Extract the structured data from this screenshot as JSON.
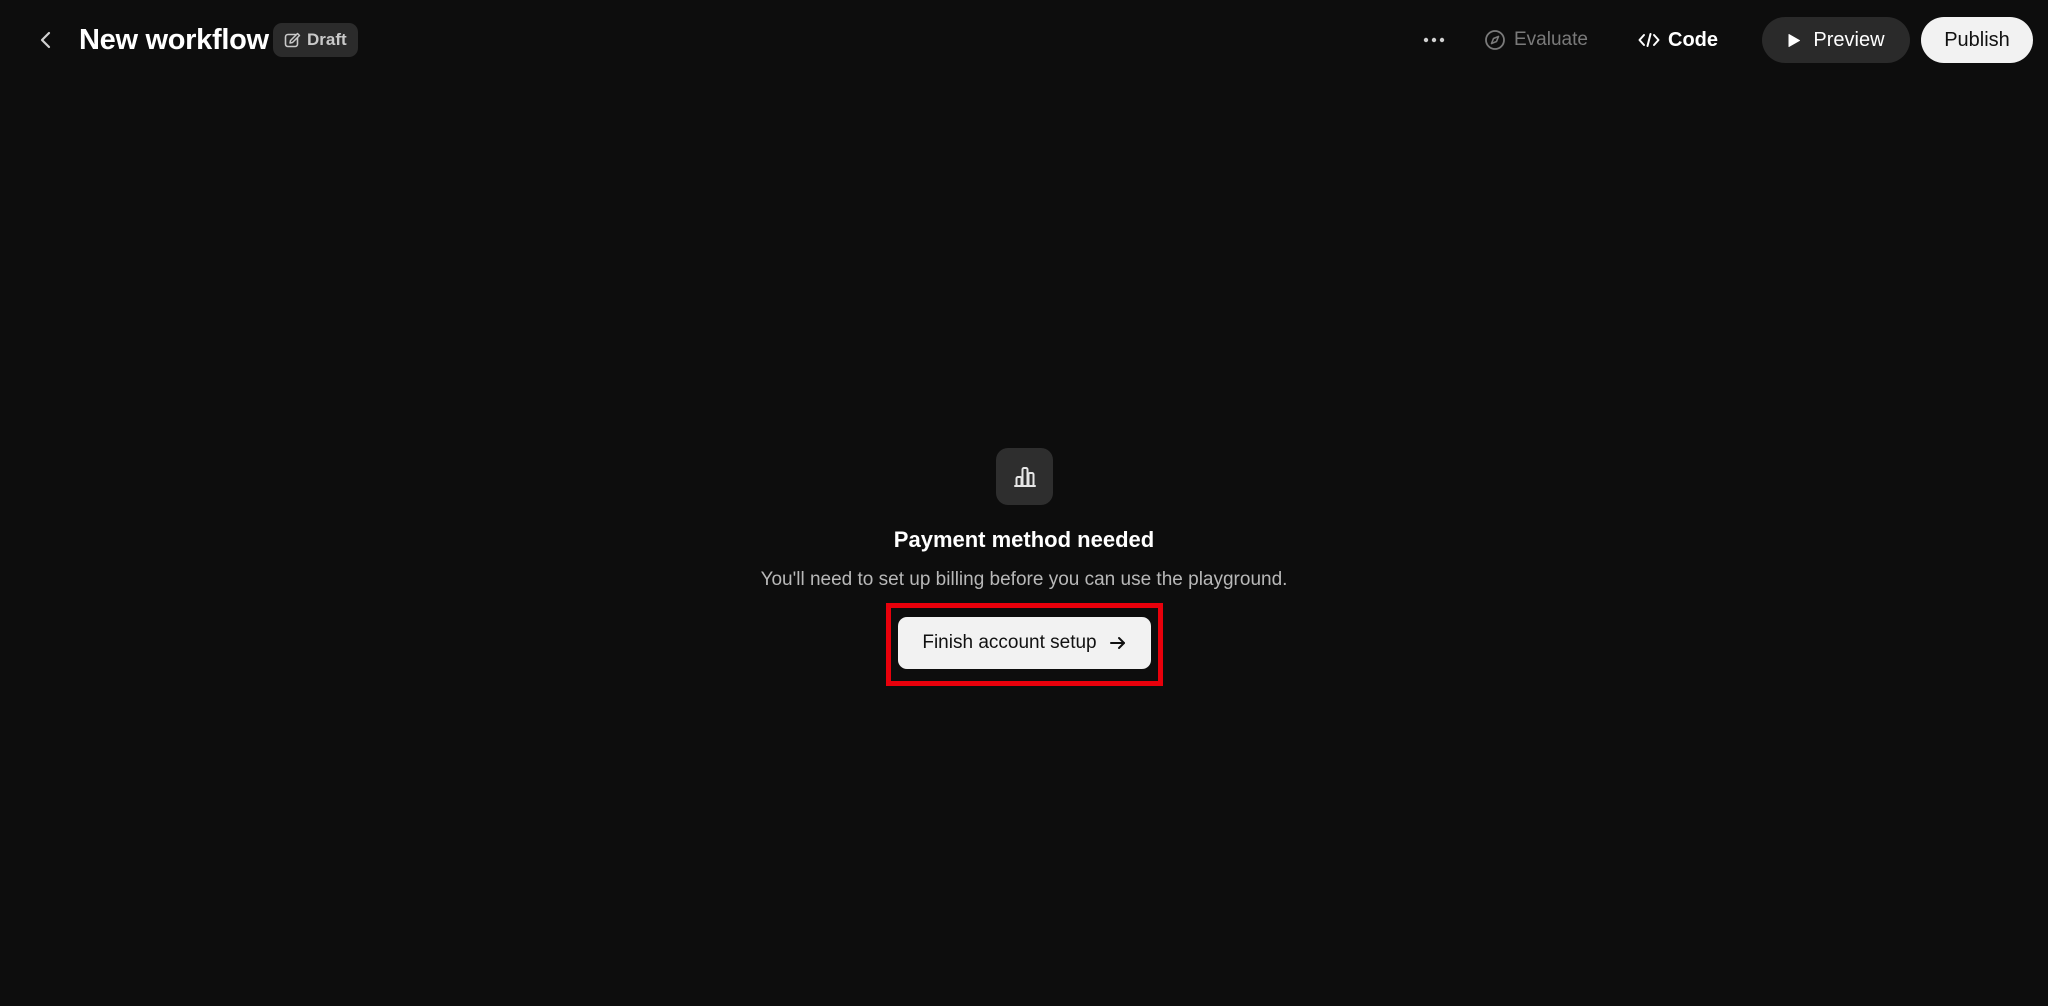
{
  "header": {
    "title": "New workflow",
    "badge_label": "Draft",
    "evaluate_label": "Evaluate",
    "code_label": "Code",
    "preview_label": "Preview",
    "publish_label": "Publish"
  },
  "empty_state": {
    "icon": "bar-chart-icon",
    "title": "Payment method needed",
    "description": "You'll need to set up billing before you can use the playground.",
    "button_label": "Finish account setup"
  },
  "colors": {
    "background": "#0d0d0d",
    "highlight": "#e8000b",
    "button_light": "#f2f2f2",
    "button_dark": "#2a2a2a"
  }
}
